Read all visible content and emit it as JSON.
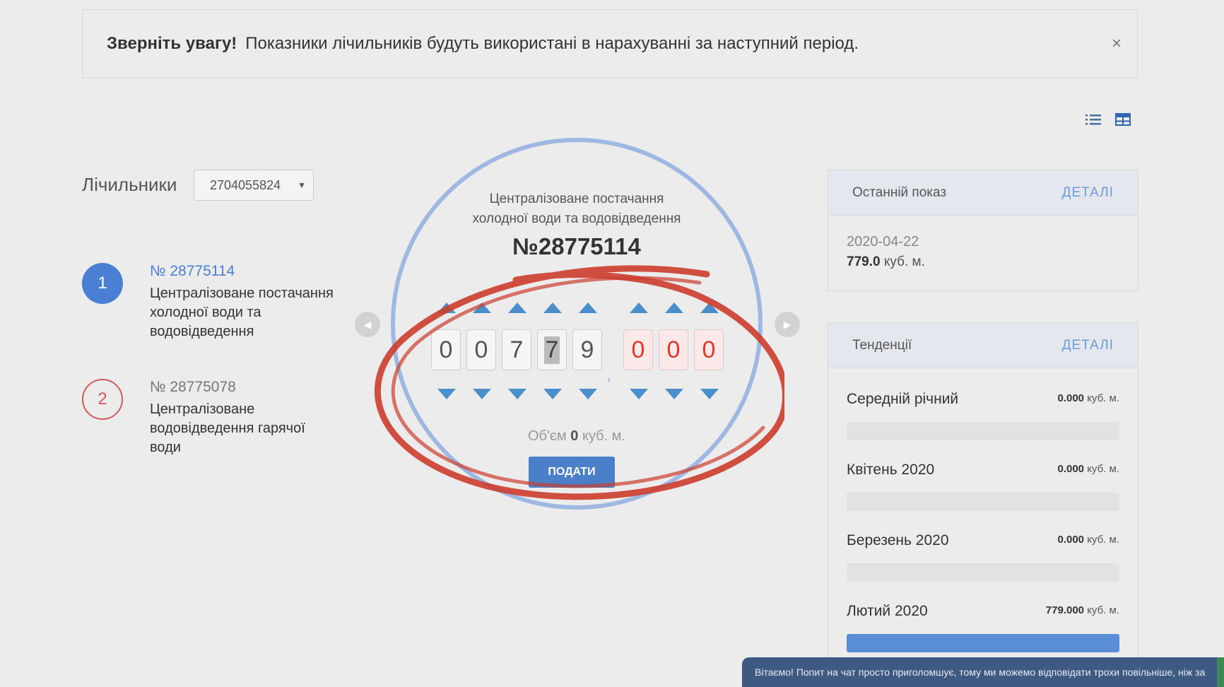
{
  "alert": {
    "bold": "Зверніть увагу!",
    "text": "Показники лічильників будуть використані в нарахуванні за наступний період.",
    "close": "×"
  },
  "view_icons": [
    "list-view-icon",
    "grid-view-icon"
  ],
  "meters": {
    "label": "Лічильники",
    "selected_account": "2704055824",
    "items": [
      {
        "num": "1",
        "id": "№ 28775114",
        "desc": "Централізоване постачання холодної води та водовідведення",
        "active": true
      },
      {
        "num": "2",
        "id": "№ 28775078",
        "desc": "Централізоване водовідведення гарячої води",
        "active": false
      }
    ]
  },
  "reading": {
    "service_line1": "Централізоване постачання",
    "service_line2": "холодної води та водовідведення",
    "meter_number": "№28775114",
    "integer_digits": [
      "0",
      "0",
      "7",
      "7",
      "9"
    ],
    "fraction_digits": [
      "0",
      "0",
      "0"
    ],
    "comma": ",",
    "volume_prefix": "Об'єм",
    "volume_value": "0",
    "volume_unit": "куб. м.",
    "submit": "ПОДАТИ"
  },
  "last_reading": {
    "title": "Останній показ",
    "details": "ДЕТАЛІ",
    "date": "2020-04-22",
    "value": "779.0",
    "unit": "куб. м."
  },
  "trends": {
    "title": "Тенденції",
    "details": "ДЕТАЛІ",
    "rows": [
      {
        "name": "Середній річний",
        "value": "0.000",
        "unit": "куб. м.",
        "fill": 0
      },
      {
        "name": "Квітень 2020",
        "value": "0.000",
        "unit": "куб. м.",
        "fill": 0
      },
      {
        "name": "Березень 2020",
        "value": "0.000",
        "unit": "куб. м.",
        "fill": 0
      },
      {
        "name": "Лютий 2020",
        "value": "779.000",
        "unit": "куб. м.",
        "fill": 1
      }
    ]
  },
  "chat": {
    "text": "Вітаємо! Попит на чат просто приголомшує, тому ми можемо відповідати трохи повільніше, ніж за"
  },
  "colors": {
    "accent": "#4a7fd4",
    "danger": "#cf5a5a",
    "annotation": "#cc3d2e"
  }
}
